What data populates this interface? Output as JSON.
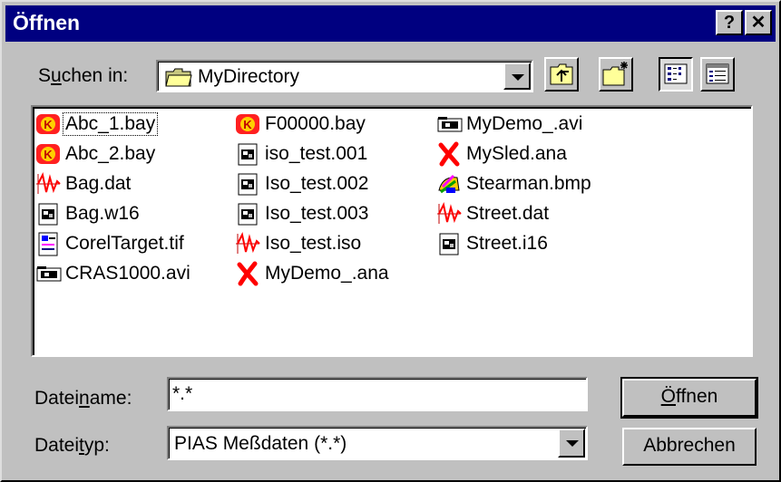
{
  "title": "Öffnen",
  "titlebar": {
    "help": "?",
    "close": "✕"
  },
  "lookin": {
    "label_pre": "S",
    "label_u": "u",
    "label_post": "chen in:",
    "value": "MyDirectory"
  },
  "toolbar": {
    "up": "up-folder",
    "new": "new-folder",
    "list": "list-view",
    "details": "details-view"
  },
  "files": [
    {
      "name": "Abc_1.bay",
      "icon": "k-icon"
    },
    {
      "name": "Abc_2.bay",
      "icon": "k-icon"
    },
    {
      "name": "Bag.dat",
      "icon": "wave-icon"
    },
    {
      "name": "Bag.w16",
      "icon": "doc-icon"
    },
    {
      "name": "CorelTarget.tif",
      "icon": "image-icon"
    },
    {
      "name": "CRAS1000.avi",
      "icon": "video-icon"
    },
    {
      "name": "F00000.bay",
      "icon": "k-icon"
    },
    {
      "name": "iso_test.001",
      "icon": "doc-icon"
    },
    {
      "name": "Iso_test.002",
      "icon": "doc-icon"
    },
    {
      "name": "Iso_test.003",
      "icon": "doc-icon"
    },
    {
      "name": "Iso_test.iso",
      "icon": "wave-icon"
    },
    {
      "name": "MyDemo_.ana",
      "icon": "x-icon"
    },
    {
      "name": "MyDemo_.avi",
      "icon": "video-icon"
    },
    {
      "name": "MySled.ana",
      "icon": "x-icon"
    },
    {
      "name": "Stearman.bmp",
      "icon": "paint-icon"
    },
    {
      "name": "Street.dat",
      "icon": "wave-icon"
    },
    {
      "name": "Street.i16",
      "icon": "doc-icon"
    }
  ],
  "filename": {
    "label_pre": "Datei",
    "label_u": "n",
    "label_post": "ame:",
    "value": "*.*"
  },
  "filetype": {
    "label_pre": "Datei",
    "label_u": "t",
    "label_post": "yp:",
    "value": "PIAS Meßdaten (*.*)"
  },
  "buttons": {
    "open_pre": "",
    "open_u": "Ö",
    "open_post": "ffnen",
    "cancel": "Abbrechen"
  }
}
